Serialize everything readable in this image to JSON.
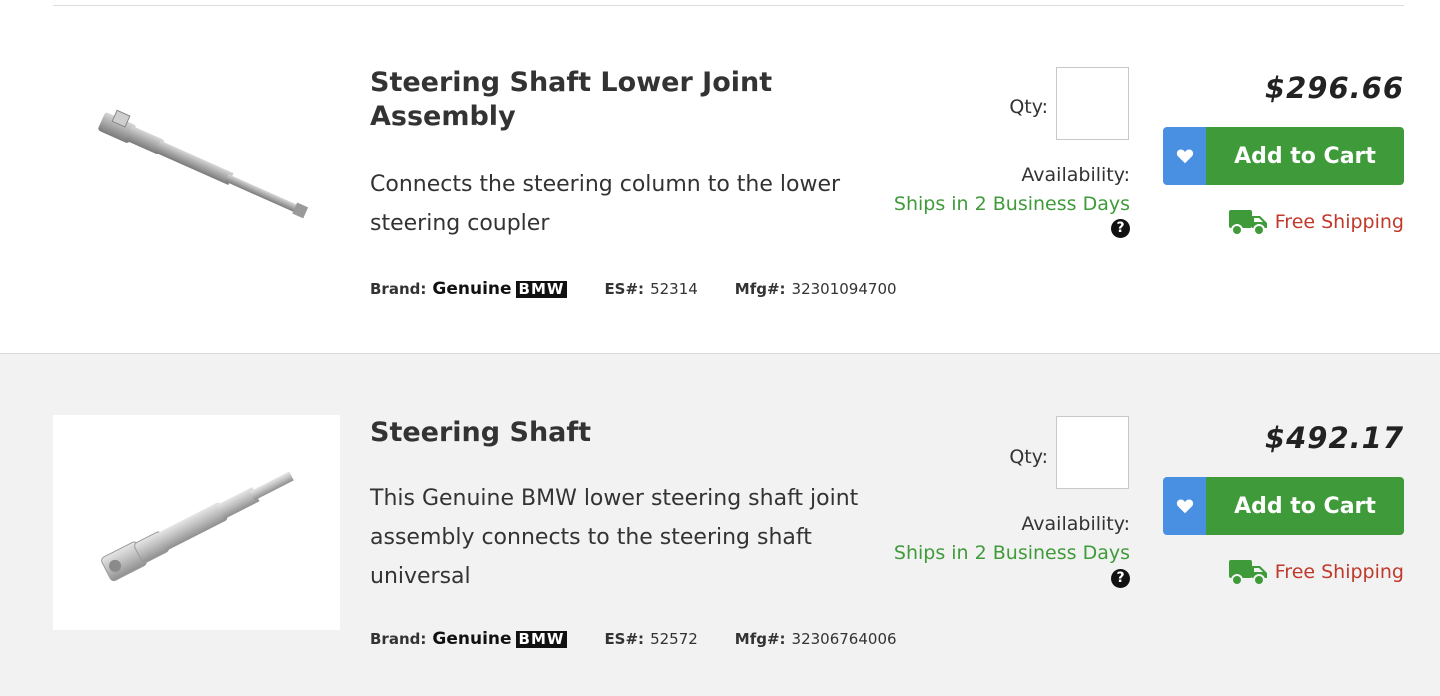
{
  "products": [
    {
      "title": "Steering Shaft Lower Joint Assembly",
      "description": "Connects the steering column to the lower steering coupler",
      "brand_label": "Brand:",
      "brand_text": "Genuine",
      "brand_logo_text": "BMW",
      "es_label": "ES#:",
      "es_number": "52314",
      "mfg_label": "Mfg#:",
      "mfg_number": "32301094700",
      "qty_label": "Qty:",
      "qty_value": "",
      "availability_label": "Availability:",
      "availability_value": "Ships in 2 Business Days",
      "help_icon": "?",
      "price": "$296.66",
      "wishlist_icon": "heart-icon",
      "add_to_cart_label": "Add to Cart",
      "shipping_icon": "truck-icon",
      "shipping_text": "Free Shipping"
    },
    {
      "title": "Steering Shaft",
      "description": "This Genuine BMW lower steering shaft joint assembly connects to the steering shaft universal",
      "brand_label": "Brand:",
      "brand_text": "Genuine",
      "brand_logo_text": "BMW",
      "es_label": "ES#:",
      "es_number": "52572",
      "mfg_label": "Mfg#:",
      "mfg_number": "32306764006",
      "qty_label": "Qty:",
      "qty_value": "",
      "availability_label": "Availability:",
      "availability_value": "Ships in 2 Business Days",
      "help_icon": "?",
      "price": "$492.17",
      "wishlist_icon": "heart-icon",
      "add_to_cart_label": "Add to Cart",
      "shipping_icon": "truck-icon",
      "shipping_text": "Free Shipping"
    }
  ],
  "colors": {
    "green": "#3f9b3a",
    "blue": "#4a90e2",
    "red": "#c0392b",
    "alt_row_bg": "#f2f2f2"
  }
}
